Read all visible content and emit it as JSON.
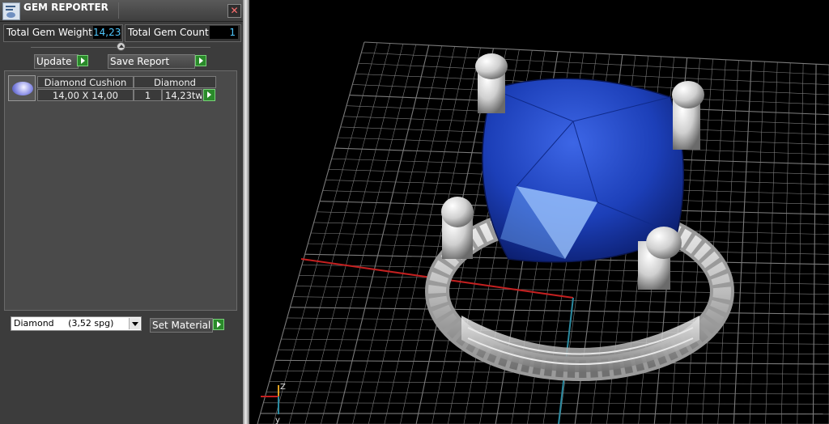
{
  "window": {
    "title": "GEM REPORTER",
    "close_glyph": "✕"
  },
  "stats": {
    "total_weight_label": "Total Gem Weight",
    "total_weight_value": "14,23",
    "total_count_label": "Total Gem Count",
    "total_count_value": "1"
  },
  "actions": {
    "update_label": "Update",
    "save_report_label": "Save Report"
  },
  "gem_list": {
    "rows": [
      {
        "icon": "diamond-cushion-thumbnail",
        "shape": "Diamond Cushion",
        "material": "Diamond",
        "size": "14,00 X 14,00",
        "count": "1",
        "weight": "14,23tw"
      }
    ]
  },
  "material_select": {
    "value": "Diamond     (3,52 spg)"
  },
  "set_material_label": "Set Material",
  "viewport": {
    "axis_labels": {
      "z": "Z",
      "y": "y"
    },
    "colors": {
      "gem": "#1c3fb8",
      "metal": "#cfcfcf",
      "x_axis": "#c42020",
      "y_axis": "#2a8aa0",
      "grid": "#7a7a7a"
    }
  },
  "icons": {
    "app": "gem-reporter-icon",
    "close": "close-icon",
    "play": "arrow-right-icon",
    "dropdown": "chevron-down-icon"
  }
}
